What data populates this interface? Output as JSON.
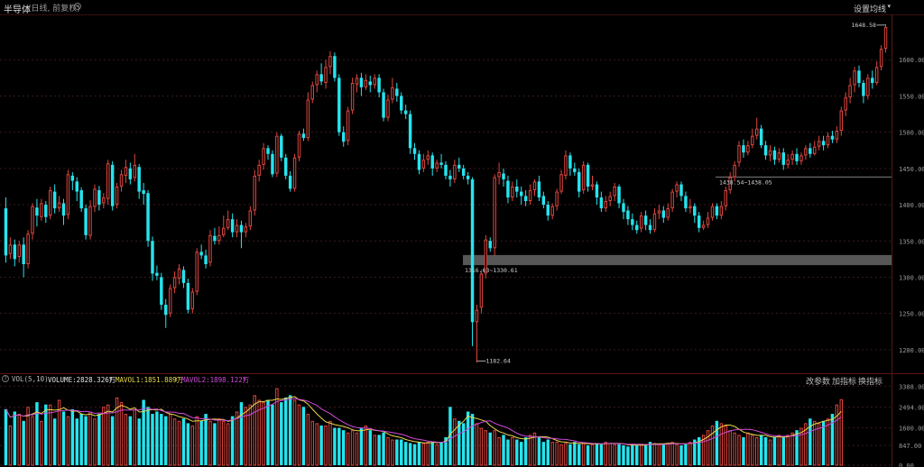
{
  "header": {
    "title": "半导体",
    "subtitle": "(日线, 前复权)",
    "settings_icon": "gear-icon",
    "ma_setting_label": "设置均线",
    "ma_setting_caret": "▾"
  },
  "colors": {
    "up": "#e0463f",
    "down": "#25e4ee",
    "grid": "#3a1a1a",
    "ma1": "#e8d84a",
    "ma2": "#d04ad8",
    "background": "#000000",
    "zone": "#6d6d6d"
  },
  "price_axis": {
    "ticks": [
      "1600.00",
      "1550.00",
      "1500.00",
      "1450.00",
      "1400.00",
      "1350.00",
      "1300.00",
      "1250.00",
      "1200.00"
    ]
  },
  "annotations": {
    "high_label": "1648.58",
    "low_label": "1182.64",
    "zone_upper_label": "1438.54~1438.05",
    "zone_lower_label": "1316.63~1330.61"
  },
  "volume": {
    "help_icon": "?",
    "indicator": "VOL(5,10)",
    "volume_label": "VOLUME:2828.326万",
    "ma1_label": "MAVOL1:1851.889万",
    "ma2_label": "MAVOL2:1898.122万",
    "arrow": "↑",
    "buttons": [
      "改参数",
      "加指标",
      "换指标"
    ],
    "ticks": [
      "3388.00",
      "2494.00",
      "1600.00",
      "847.00",
      "0.00"
    ]
  },
  "chart_data": {
    "type": "candlestick",
    "ylim": [
      1170,
      1660
    ],
    "volume_ylim": [
      0,
      3400
    ],
    "candles": [
      [
        1395,
        1330,
        1410,
        1320
      ],
      [
        1332,
        1345,
        1355,
        1325
      ],
      [
        1345,
        1325,
        1352,
        1315
      ],
      [
        1328,
        1345,
        1350,
        1320
      ],
      [
        1345,
        1318,
        1355,
        1300
      ],
      [
        1318,
        1360,
        1365,
        1312
      ],
      [
        1360,
        1398,
        1402,
        1352
      ],
      [
        1396,
        1385,
        1408,
        1370
      ],
      [
        1383,
        1402,
        1408,
        1378
      ],
      [
        1400,
        1383,
        1405,
        1375
      ],
      [
        1385,
        1420,
        1425,
        1380
      ],
      [
        1418,
        1395,
        1428,
        1388
      ],
      [
        1395,
        1403,
        1412,
        1390
      ],
      [
        1402,
        1385,
        1408,
        1372
      ],
      [
        1386,
        1442,
        1448,
        1380
      ],
      [
        1440,
        1433,
        1445,
        1420
      ],
      [
        1432,
        1418,
        1438,
        1405
      ],
      [
        1420,
        1395,
        1424,
        1390
      ],
      [
        1395,
        1358,
        1400,
        1352
      ],
      [
        1357,
        1398,
        1406,
        1352
      ],
      [
        1397,
        1422,
        1428,
        1390
      ],
      [
        1420,
        1400,
        1426,
        1392
      ],
      [
        1402,
        1410,
        1416,
        1395
      ],
      [
        1408,
        1457,
        1462,
        1400
      ],
      [
        1455,
        1398,
        1460,
        1392
      ],
      [
        1400,
        1425,
        1430,
        1395
      ],
      [
        1425,
        1442,
        1448,
        1418
      ],
      [
        1440,
        1452,
        1462,
        1430
      ],
      [
        1450,
        1435,
        1458,
        1428
      ],
      [
        1437,
        1455,
        1470,
        1432
      ],
      [
        1452,
        1418,
        1456,
        1408
      ],
      [
        1420,
        1415,
        1430,
        1400
      ],
      [
        1416,
        1350,
        1420,
        1342
      ],
      [
        1350,
        1305,
        1356,
        1295
      ],
      [
        1306,
        1302,
        1316,
        1296
      ],
      [
        1300,
        1262,
        1306,
        1255
      ],
      [
        1262,
        1248,
        1270,
        1230
      ],
      [
        1250,
        1285,
        1290,
        1245
      ],
      [
        1285,
        1300,
        1308,
        1278
      ],
      [
        1298,
        1312,
        1318,
        1290
      ],
      [
        1310,
        1292,
        1315,
        1285
      ],
      [
        1292,
        1255,
        1298,
        1250
      ],
      [
        1256,
        1280,
        1285,
        1250
      ],
      [
        1280,
        1335,
        1340,
        1275
      ],
      [
        1335,
        1330,
        1345,
        1325
      ],
      [
        1330,
        1318,
        1338,
        1312
      ],
      [
        1320,
        1358,
        1365,
        1315
      ],
      [
        1357,
        1350,
        1368,
        1345
      ],
      [
        1350,
        1358,
        1370,
        1345
      ],
      [
        1358,
        1368,
        1385,
        1355
      ],
      [
        1368,
        1380,
        1392,
        1365
      ],
      [
        1380,
        1362,
        1388,
        1355
      ],
      [
        1362,
        1372,
        1380,
        1355
      ],
      [
        1372,
        1362,
        1378,
        1340
      ],
      [
        1362,
        1370,
        1375,
        1355
      ],
      [
        1370,
        1392,
        1398,
        1365
      ],
      [
        1392,
        1440,
        1448,
        1385
      ],
      [
        1440,
        1455,
        1462,
        1432
      ],
      [
        1455,
        1478,
        1485,
        1448
      ],
      [
        1478,
        1470,
        1482,
        1462
      ],
      [
        1470,
        1442,
        1475,
        1438
      ],
      [
        1443,
        1495,
        1500,
        1438
      ],
      [
        1495,
        1465,
        1498,
        1460
      ],
      [
        1465,
        1440,
        1470,
        1435
      ],
      [
        1440,
        1422,
        1446,
        1418
      ],
      [
        1422,
        1465,
        1470,
        1418
      ],
      [
        1465,
        1498,
        1502,
        1460
      ],
      [
        1498,
        1492,
        1505,
        1488
      ],
      [
        1492,
        1545,
        1555,
        1488
      ],
      [
        1545,
        1565,
        1570,
        1540
      ],
      [
        1565,
        1580,
        1585,
        1555
      ],
      [
        1580,
        1570,
        1595,
        1565
      ],
      [
        1568,
        1590,
        1600,
        1560
      ],
      [
        1590,
        1605,
        1612,
        1580
      ],
      [
        1605,
        1575,
        1610,
        1570
      ],
      [
        1575,
        1500,
        1580,
        1495
      ],
      [
        1500,
        1487,
        1508,
        1480
      ],
      [
        1488,
        1530,
        1535,
        1482
      ],
      [
        1530,
        1568,
        1575,
        1525
      ],
      [
        1566,
        1575,
        1580,
        1555
      ],
      [
        1575,
        1562,
        1582,
        1550
      ],
      [
        1562,
        1572,
        1580,
        1558
      ],
      [
        1570,
        1565,
        1578,
        1555
      ],
      [
        1565,
        1575,
        1580,
        1560
      ],
      [
        1575,
        1555,
        1580,
        1548
      ],
      [
        1555,
        1520,
        1560,
        1515
      ],
      [
        1520,
        1545,
        1552,
        1515
      ],
      [
        1545,
        1562,
        1575,
        1540
      ],
      [
        1560,
        1550,
        1568,
        1542
      ],
      [
        1550,
        1530,
        1555,
        1525
      ],
      [
        1530,
        1525,
        1538,
        1518
      ],
      [
        1525,
        1478,
        1530,
        1470
      ],
      [
        1478,
        1470,
        1485,
        1462
      ],
      [
        1470,
        1448,
        1475,
        1442
      ],
      [
        1450,
        1462,
        1470,
        1445
      ],
      [
        1462,
        1468,
        1475,
        1455
      ],
      [
        1468,
        1450,
        1472,
        1440
      ],
      [
        1450,
        1458,
        1462,
        1445
      ],
      [
        1458,
        1455,
        1470,
        1450
      ],
      [
        1455,
        1440,
        1460,
        1435
      ],
      [
        1440,
        1435,
        1448,
        1425
      ],
      [
        1435,
        1455,
        1462,
        1430
      ],
      [
        1455,
        1450,
        1465,
        1445
      ],
      [
        1450,
        1440,
        1455,
        1435
      ],
      [
        1440,
        1435,
        1445,
        1428
      ],
      [
        1435,
        1238,
        1438,
        1205
      ],
      [
        1238,
        1255,
        1262,
        1182
      ],
      [
        1258,
        1305,
        1310,
        1250
      ],
      [
        1305,
        1352,
        1358,
        1298
      ],
      [
        1350,
        1340,
        1355,
        1335
      ],
      [
        1340,
        1438,
        1442,
        1330
      ],
      [
        1438,
        1445,
        1458,
        1428
      ],
      [
        1443,
        1435,
        1450,
        1425
      ],
      [
        1433,
        1410,
        1440,
        1402
      ],
      [
        1410,
        1425,
        1432,
        1405
      ],
      [
        1425,
        1418,
        1435,
        1410
      ],
      [
        1418,
        1412,
        1425,
        1400
      ],
      [
        1412,
        1405,
        1420,
        1398
      ],
      [
        1405,
        1420,
        1428,
        1400
      ],
      [
        1420,
        1432,
        1435,
        1412
      ],
      [
        1432,
        1410,
        1440,
        1405
      ],
      [
        1412,
        1400,
        1418,
        1395
      ],
      [
        1400,
        1385,
        1405,
        1378
      ],
      [
        1385,
        1398,
        1402,
        1380
      ],
      [
        1398,
        1418,
        1422,
        1392
      ],
      [
        1418,
        1442,
        1448,
        1415
      ],
      [
        1440,
        1468,
        1475,
        1435
      ],
      [
        1468,
        1450,
        1472,
        1440
      ],
      [
        1450,
        1445,
        1458,
        1440
      ],
      [
        1445,
        1418,
        1450,
        1410
      ],
      [
        1420,
        1455,
        1460,
        1415
      ],
      [
        1455,
        1425,
        1458,
        1418
      ],
      [
        1425,
        1428,
        1440,
        1420
      ],
      [
        1428,
        1410,
        1432,
        1400
      ],
      [
        1410,
        1395,
        1418,
        1390
      ],
      [
        1395,
        1405,
        1412,
        1390
      ],
      [
        1405,
        1412,
        1418,
        1398
      ],
      [
        1412,
        1425,
        1430,
        1405
      ],
      [
        1425,
        1402,
        1428,
        1395
      ],
      [
        1402,
        1390,
        1408,
        1380
      ],
      [
        1392,
        1380,
        1398,
        1372
      ],
      [
        1380,
        1372,
        1388,
        1365
      ],
      [
        1372,
        1365,
        1378,
        1360
      ],
      [
        1367,
        1385,
        1390,
        1362
      ],
      [
        1385,
        1372,
        1392,
        1365
      ],
      [
        1372,
        1365,
        1380,
        1360
      ],
      [
        1365,
        1388,
        1395,
        1362
      ],
      [
        1388,
        1392,
        1400,
        1380
      ],
      [
        1392,
        1382,
        1398,
        1375
      ],
      [
        1382,
        1395,
        1402,
        1378
      ],
      [
        1395,
        1418,
        1422,
        1390
      ],
      [
        1418,
        1428,
        1432,
        1410
      ],
      [
        1428,
        1412,
        1432,
        1405
      ],
      [
        1412,
        1395,
        1418,
        1390
      ],
      [
        1395,
        1398,
        1408,
        1388
      ],
      [
        1398,
        1385,
        1402,
        1375
      ],
      [
        1385,
        1368,
        1390,
        1362
      ],
      [
        1368,
        1372,
        1378,
        1365
      ],
      [
        1372,
        1382,
        1390,
        1368
      ],
      [
        1382,
        1398,
        1402,
        1378
      ],
      [
        1398,
        1385,
        1402,
        1380
      ],
      [
        1385,
        1398,
        1405,
        1380
      ],
      [
        1398,
        1420,
        1425,
        1392
      ],
      [
        1420,
        1438,
        1445,
        1415
      ],
      [
        1438,
        1455,
        1460,
        1432
      ],
      [
        1458,
        1482,
        1488,
        1452
      ],
      [
        1482,
        1472,
        1490,
        1465
      ],
      [
        1472,
        1482,
        1488,
        1468
      ],
      [
        1482,
        1495,
        1505,
        1478
      ],
      [
        1495,
        1505,
        1520,
        1490
      ],
      [
        1505,
        1482,
        1510,
        1478
      ],
      [
        1482,
        1468,
        1488,
        1462
      ],
      [
        1468,
        1475,
        1482,
        1460
      ],
      [
        1475,
        1462,
        1480,
        1455
      ],
      [
        1462,
        1472,
        1478,
        1458
      ],
      [
        1472,
        1455,
        1478,
        1448
      ],
      [
        1455,
        1462,
        1470,
        1450
      ],
      [
        1462,
        1470,
        1475,
        1455
      ],
      [
        1470,
        1460,
        1478,
        1455
      ],
      [
        1460,
        1468,
        1472,
        1455
      ],
      [
        1468,
        1478,
        1482,
        1462
      ],
      [
        1478,
        1470,
        1485,
        1465
      ],
      [
        1470,
        1480,
        1488,
        1468
      ],
      [
        1480,
        1488,
        1495,
        1475
      ],
      [
        1488,
        1482,
        1495,
        1475
      ],
      [
        1482,
        1495,
        1500,
        1478
      ],
      [
        1495,
        1490,
        1502,
        1485
      ],
      [
        1490,
        1502,
        1508,
        1485
      ],
      [
        1502,
        1530,
        1535,
        1495
      ],
      [
        1530,
        1548,
        1555,
        1522
      ],
      [
        1548,
        1565,
        1575,
        1540
      ],
      [
        1565,
        1585,
        1590,
        1555
      ],
      [
        1585,
        1568,
        1592,
        1562
      ],
      [
        1568,
        1550,
        1572,
        1540
      ],
      [
        1550,
        1575,
        1580,
        1545
      ],
      [
        1575,
        1568,
        1585,
        1560
      ],
      [
        1568,
        1590,
        1598,
        1565
      ],
      [
        1590,
        1615,
        1620,
        1585
      ],
      [
        1615,
        1645,
        1649,
        1610
      ]
    ],
    "volumes": [
      2400,
      1700,
      2300,
      2200,
      1900,
      2500,
      2100,
      2700,
      1900,
      2600,
      2600,
      2000,
      2800,
      2300,
      2100,
      2400,
      2000,
      2200,
      2100,
      2300,
      2000,
      2200,
      2500,
      2600,
      2100,
      2900,
      2700,
      2200,
      2100,
      2400,
      2000,
      2800,
      2500,
      2200,
      2300,
      2200,
      2100,
      2200,
      2000,
      1900,
      2000,
      1800,
      1700,
      2100,
      1900,
      2200,
      1900,
      1800,
      2000,
      1900,
      1800,
      2100,
      2300,
      2700,
      2500,
      2600,
      3000,
      2800,
      2700,
      2800,
      2600,
      3300,
      2700,
      2900,
      3000,
      2800,
      2600,
      2500,
      2200,
      1900,
      1800,
      1700,
      1700,
      1900,
      1600,
      1600,
      1500,
      1400,
      1500,
      1400,
      1600,
      1700,
      1500,
      1300,
      1300,
      1400,
      1200,
      1100,
      1100,
      1100,
      1000,
      950,
      900,
      1000,
      950,
      1000,
      1000,
      900,
      1000,
      1200,
      2500,
      2000,
      1900,
      1800,
      2300,
      2200,
      1800,
      1600,
      1500,
      1400,
      1500,
      1200,
      1300,
      1100,
      1200,
      1100,
      1000,
      1200,
      1300,
      1400,
      1200,
      1000,
      1100,
      1000,
      1000,
      900,
      950,
      900,
      1000,
      900,
      950,
      850,
      900,
      950,
      900,
      1000,
      950,
      900,
      900,
      850,
      800,
      900,
      850,
      900,
      850,
      1000,
      950,
      900,
      900,
      950,
      1000,
      900,
      850,
      900,
      1000,
      1100,
      1200,
      1300,
      1500,
      1700,
      1900,
      1800,
      1700,
      1500,
      1400,
      1300,
      1200,
      1400,
      1300,
      1200,
      1300,
      1200,
      1100,
      1200,
      1300,
      1200,
      1300,
      1400,
      1500,
      1600,
      1800,
      2000,
      1900,
      1800,
      1900,
      2000,
      2200,
      2600,
      2829
    ]
  }
}
